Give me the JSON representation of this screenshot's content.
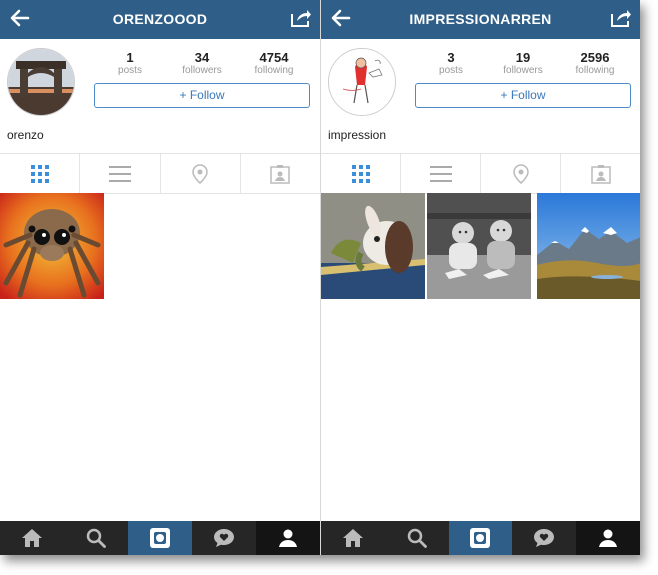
{
  "left_screen": {
    "header": {
      "title": "ORENZOOOD"
    },
    "stats": [
      {
        "value": "1",
        "label": "posts"
      },
      {
        "value": "34",
        "label": "followers"
      },
      {
        "value": "4754",
        "label": "following"
      }
    ],
    "follow_label": "+ Follow",
    "username": "orenzo",
    "photos": [
      "jumping-spider"
    ]
  },
  "right_screen": {
    "header": {
      "title": "IMPRESSIONARREN"
    },
    "stats": [
      {
        "value": "3",
        "label": "posts"
      },
      {
        "value": "19",
        "label": "followers"
      },
      {
        "value": "2596",
        "label": "following"
      }
    ],
    "follow_label": "+ Follow",
    "username": "impression",
    "photos": [
      "rabbit",
      "twin-babies",
      "mountains"
    ]
  },
  "profile_tabs": [
    "grid-icon",
    "list-icon",
    "location-pin-icon",
    "tagged-photos-icon"
  ],
  "tab_bar": [
    "home-icon",
    "search-icon",
    "camera-icon",
    "activity-icon",
    "profile-icon"
  ],
  "colors": {
    "header": "#2f5f88",
    "accent": "#3a78b8",
    "tabbar": "#262626"
  }
}
